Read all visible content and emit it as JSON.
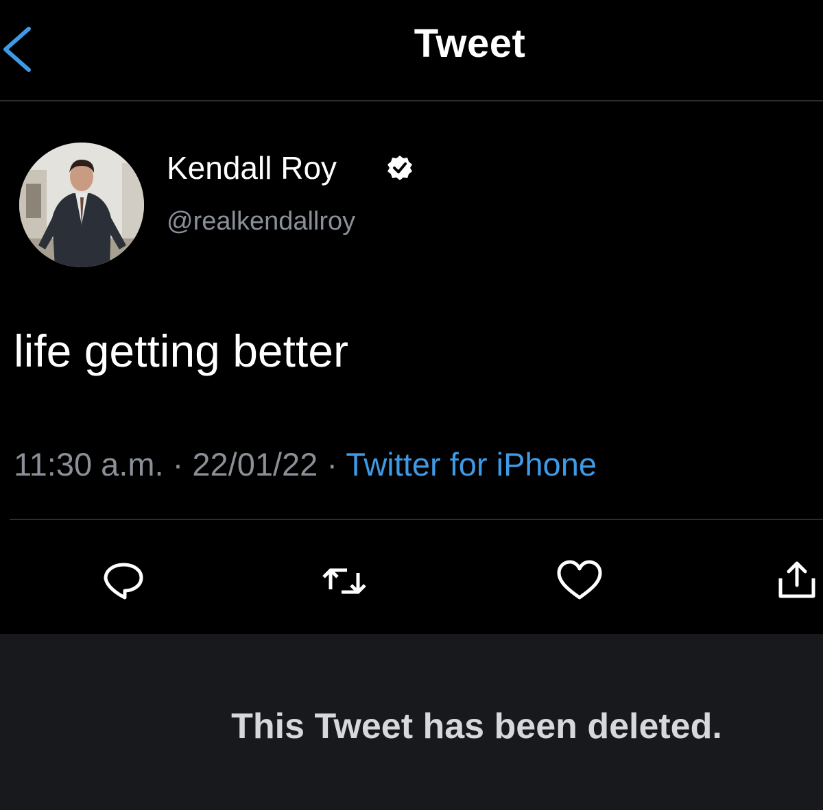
{
  "header": {
    "title": "Tweet",
    "back_icon": "chevron-left-icon",
    "accent_color": "#3f9ae6"
  },
  "author": {
    "name": "Kendall Roy",
    "handle": "@realkendallroy",
    "verified_icon": "verified-badge-icon"
  },
  "tweet": {
    "text": "life getting better",
    "time": "11:30 a.m.",
    "date": "22/01/22",
    "separator": " · ",
    "source": "Twitter for iPhone"
  },
  "actions": [
    {
      "icon": "reply-icon"
    },
    {
      "icon": "retweet-icon"
    },
    {
      "icon": "like-icon"
    },
    {
      "icon": "share-icon"
    }
  ],
  "status": {
    "message": "This Tweet has been deleted."
  },
  "colors": {
    "background": "#000000",
    "text": "#ffffff",
    "secondary_text": "#8b9098",
    "link": "#3f9ae6",
    "deleted_panel": "#17191c"
  }
}
